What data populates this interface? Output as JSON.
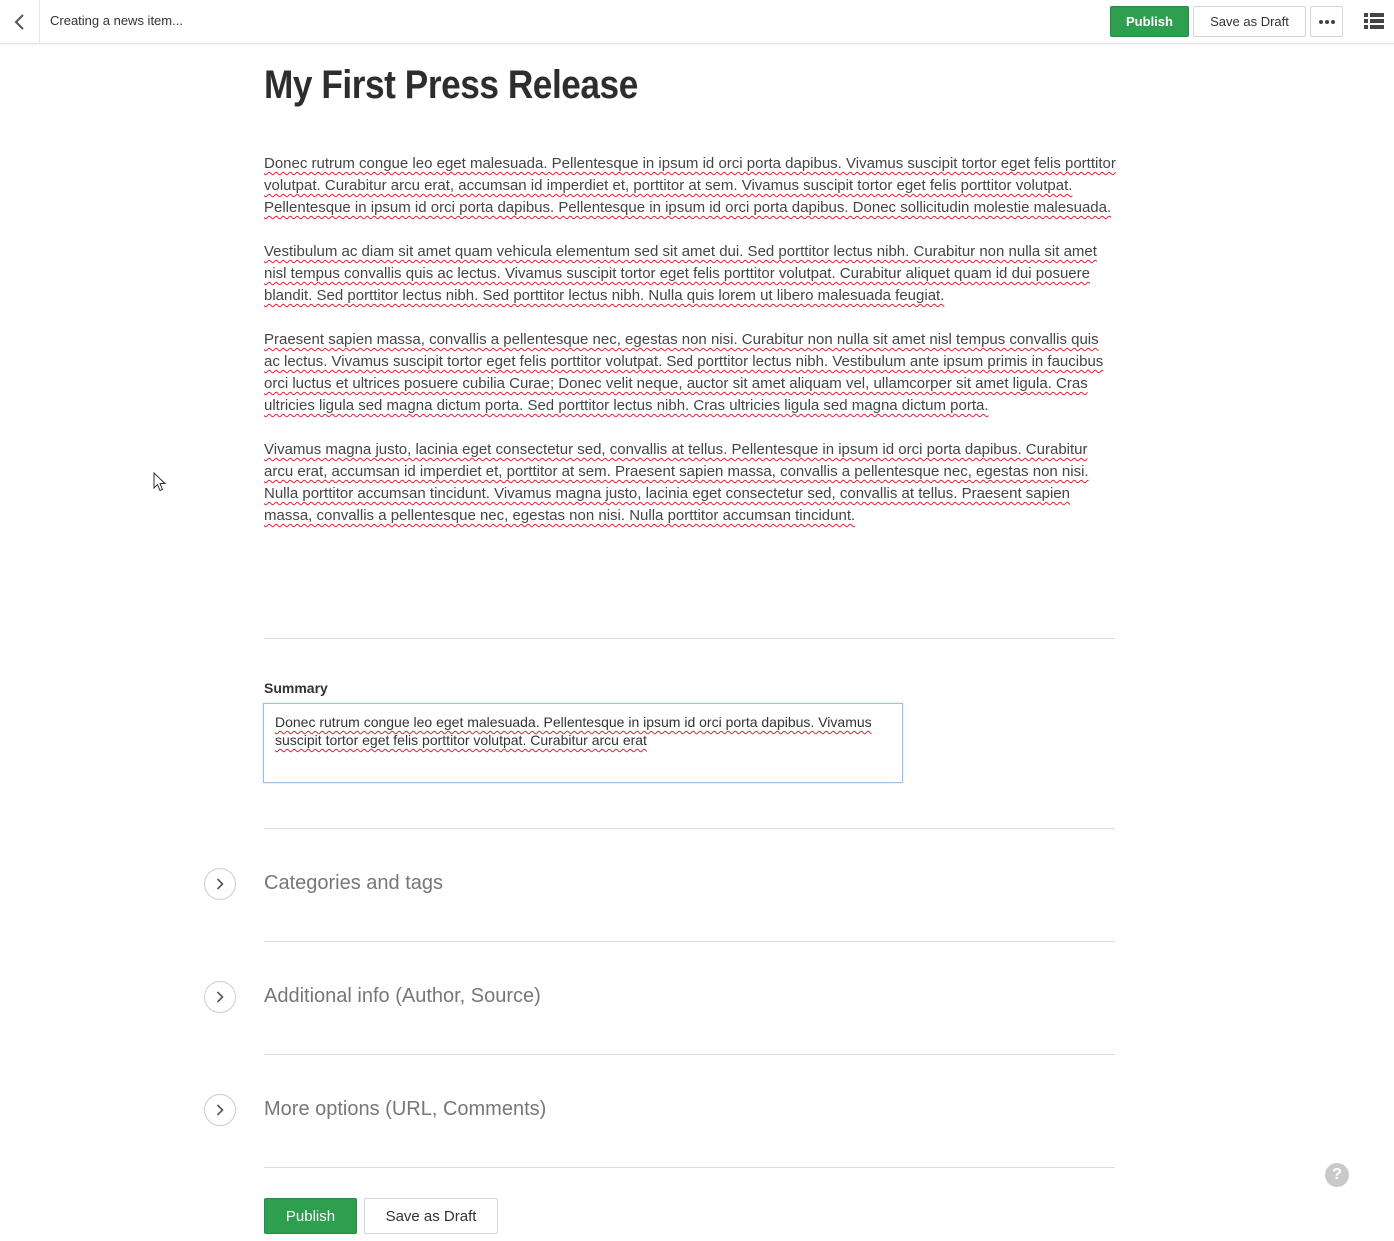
{
  "header": {
    "title": "Creating a news item...",
    "publish_label": "Publish",
    "draft_label": "Save as Draft"
  },
  "article": {
    "title": "My First Press Release",
    "paragraphs": [
      "Donec rutrum congue leo eget malesuada. Pellentesque in ipsum id orci porta dapibus. Vivamus suscipit tortor eget felis porttitor volutpat. Curabitur arcu erat, accumsan id imperdiet et, porttitor at sem. Vivamus suscipit tortor eget felis porttitor volutpat. Pellentesque in ipsum id orci porta dapibus. Pellentesque in ipsum id orci porta dapibus. Donec sollicitudin molestie malesuada.",
      "Vestibulum ac diam sit amet quam vehicula elementum sed sit amet dui. Sed porttitor lectus nibh. Curabitur non nulla sit amet nisl tempus convallis quis ac lectus. Vivamus suscipit tortor eget felis porttitor volutpat. Curabitur aliquet quam id dui posuere blandit. Sed porttitor lectus nibh. Sed porttitor lectus nibh. Nulla quis lorem ut libero malesuada feugiat.",
      "Praesent sapien massa, convallis a pellentesque nec, egestas non nisi. Curabitur non nulla sit amet nisl tempus convallis quis ac lectus. Vivamus suscipit tortor eget felis porttitor volutpat. Sed porttitor lectus nibh. Vestibulum ante ipsum primis in faucibus orci luctus et ultrices posuere cubilia Curae; Donec velit neque, auctor sit amet aliquam vel, ullamcorper sit amet ligula. Cras ultricies ligula sed magna dictum porta. Sed porttitor lectus nibh. Cras ultricies ligula sed magna dictum porta.",
      "Vivamus magna justo, lacinia eget consectetur sed, convallis at tellus. Pellentesque in ipsum id orci porta dapibus. Curabitur arcu erat, accumsan id imperdiet et, porttitor at sem. Praesent sapien massa, convallis a pellentesque nec, egestas non nisi. Nulla porttitor accumsan tincidunt. Vivamus magna justo, lacinia eget consectetur sed, convallis at tellus. Praesent sapien massa, convallis a pellentesque nec, egestas non nisi. Nulla porttitor accumsan tincidunt."
    ]
  },
  "summary": {
    "label": "Summary",
    "value": "Donec rutrum congue leo eget malesuada. Pellentesque in ipsum id orci porta dapibus. Vivamus suscipit tortor eget felis porttitor volutpat. Curabitur arcu erat"
  },
  "sections": [
    {
      "label": "Categories and tags"
    },
    {
      "label": "Additional info (Author, Source)"
    },
    {
      "label": "More options (URL, Comments)"
    }
  ],
  "footer": {
    "publish_label": "Publish",
    "draft_label": "Save as Draft"
  },
  "help": {
    "glyph": "?"
  },
  "colors": {
    "publish_green": "#2e9e4f",
    "spellcheck_underline": "#dd2233",
    "summary_border": "#9dc2e3"
  }
}
